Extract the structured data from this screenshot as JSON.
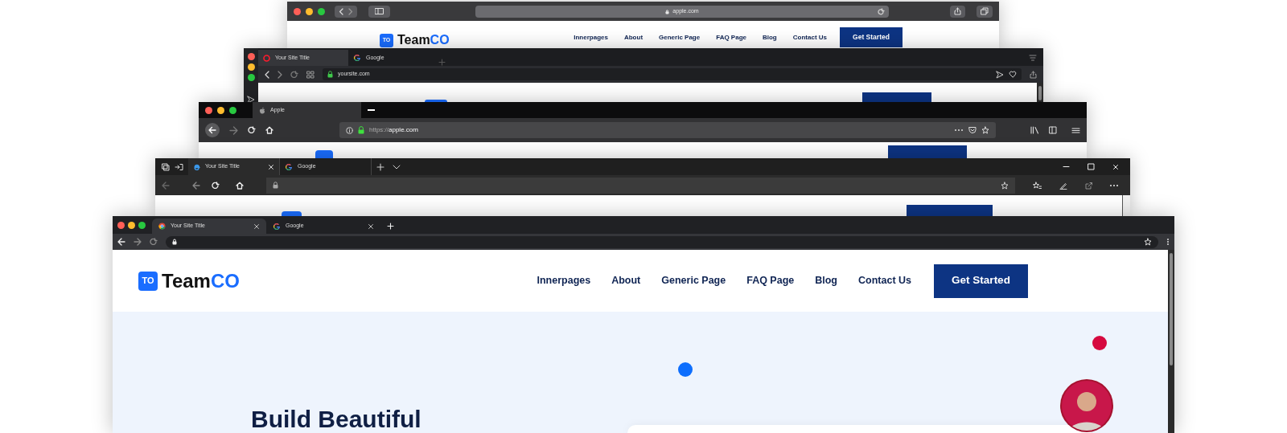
{
  "windows": [
    {
      "kind": "safari",
      "address": "apple.com",
      "site": {
        "logo_badge": "TO",
        "logo_text": "Team",
        "logo_accent": "CO",
        "nav": [
          "Innerpages",
          "About",
          "Generic Page",
          "FAQ Page",
          "Blog",
          "Contact Us"
        ],
        "cta": "Get Started"
      }
    },
    {
      "kind": "opera",
      "tabs": [
        {
          "title": "Your Site Title",
          "selected": true
        },
        {
          "title": "Google",
          "selected": false
        }
      ],
      "address": "yoursite.com"
    },
    {
      "kind": "firefox",
      "tabs": [
        {
          "title": "Apple",
          "selected": true
        }
      ],
      "address_prefix": "https://",
      "address": "apple.com"
    },
    {
      "kind": "edge",
      "tabs": [
        {
          "title": "Your Site Title",
          "selected": true
        },
        {
          "title": "Google",
          "selected": false
        }
      ]
    },
    {
      "kind": "chrome",
      "tabs": [
        {
          "title": "Your Site Title",
          "selected": true
        },
        {
          "title": "Google",
          "selected": false
        }
      ],
      "site": {
        "logo_badge": "TO",
        "logo_text": "Team",
        "logo_accent": "CO",
        "nav": [
          "Innerpages",
          "About",
          "Generic Page",
          "FAQ Page",
          "Blog",
          "Contact Us"
        ],
        "cta": "Get Started"
      },
      "hero": {
        "heading": "Build Beautiful"
      }
    }
  ]
}
